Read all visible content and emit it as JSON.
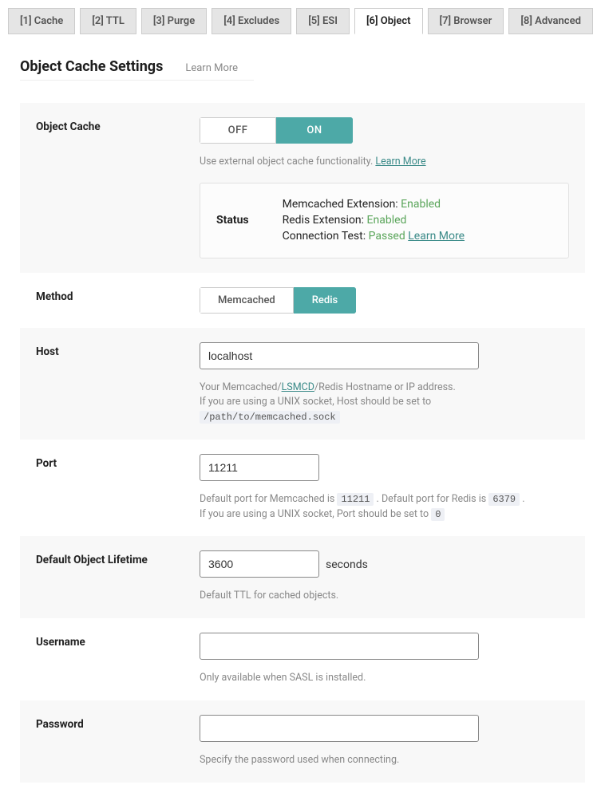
{
  "tabs": [
    {
      "label": "[1] Cache"
    },
    {
      "label": "[2] TTL"
    },
    {
      "label": "[3] Purge"
    },
    {
      "label": "[4] Excludes"
    },
    {
      "label": "[5] ESI"
    },
    {
      "label": "[6] Object"
    },
    {
      "label": "[7] Browser"
    },
    {
      "label": "[8] Advanced"
    }
  ],
  "heading": "Object Cache Settings",
  "heading_learn_more": "Learn More",
  "object_cache": {
    "label": "Object Cache",
    "off": "OFF",
    "on": "ON",
    "desc": "Use external object cache functionality. ",
    "learn_more": "Learn More",
    "status": {
      "title": "Status",
      "memcached_label": "Memcached Extension: ",
      "memcached_value": "Enabled",
      "redis_label": "Redis Extension: ",
      "redis_value": "Enabled",
      "conn_label": "Connection Test: ",
      "conn_value": "Passed",
      "learn_more": "Learn More"
    }
  },
  "method": {
    "label": "Method",
    "memcached": "Memcached",
    "redis": "Redis"
  },
  "host": {
    "label": "Host",
    "value": "localhost",
    "desc1a": "Your Memcached/",
    "lsmcd": "LSMCD",
    "desc1b": "/Redis Hostname or IP address.",
    "desc2": "If you are using a UNIX socket, Host should be set to ",
    "code": "/path/to/memcached.sock"
  },
  "port": {
    "label": "Port",
    "value": "11211",
    "desc1a": "Default port for Memcached is ",
    "code1": "11211",
    "desc1b": " . Default port for Redis is ",
    "code2": "6379",
    "desc1c": " .",
    "desc2": "If you are using a UNIX socket, Port should be set to ",
    "code3": "0"
  },
  "lifetime": {
    "label": "Default Object Lifetime",
    "value": "3600",
    "unit": "seconds",
    "desc": "Default TTL for cached objects."
  },
  "username": {
    "label": "Username",
    "value": "",
    "desc": "Only available when SASL is installed."
  },
  "password": {
    "label": "Password",
    "value": "",
    "desc": "Specify the password used when connecting."
  }
}
